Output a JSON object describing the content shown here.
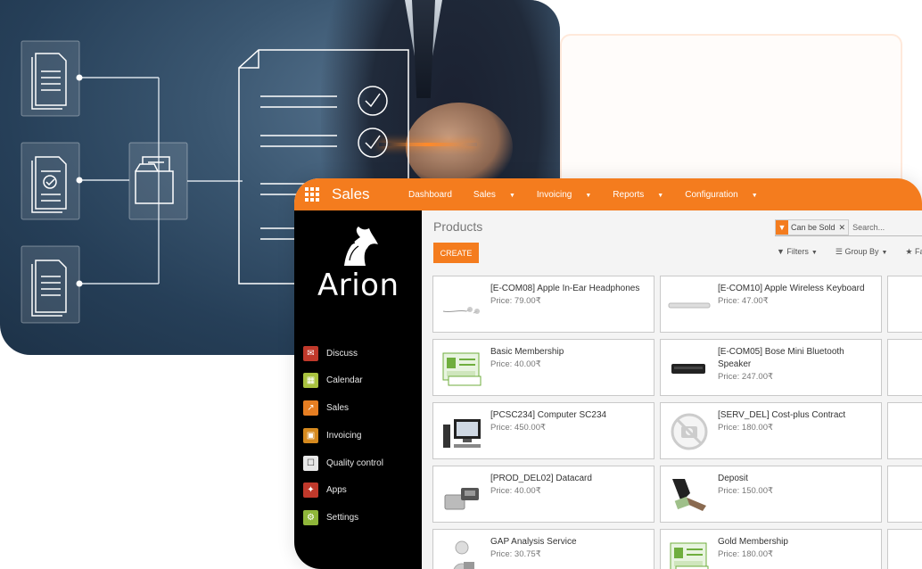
{
  "app": {
    "title": "Sales",
    "menu": [
      "Dashboard",
      "Sales",
      "Invoicing",
      "Reports",
      "Configuration"
    ],
    "menu_dropdown": [
      false,
      true,
      true,
      true,
      true
    ]
  },
  "sidebar": {
    "logo_text": "Arion",
    "items": [
      {
        "label": "Discuss",
        "icon": "discuss-icon",
        "color": "#c0392b"
      },
      {
        "label": "Calendar",
        "icon": "calendar-icon",
        "color": "#a9c23f"
      },
      {
        "label": "Sales",
        "icon": "sales-icon",
        "color": "#e67e22"
      },
      {
        "label": "Invoicing",
        "icon": "invoicing-icon",
        "color": "#d68a1f"
      },
      {
        "label": "Quality control",
        "icon": "quality-control-icon",
        "color": "#e8e8e8"
      },
      {
        "label": "Apps",
        "icon": "apps-icon",
        "color": "#c0392b"
      },
      {
        "label": "Settings",
        "icon": "settings-icon",
        "color": "#8fb63a"
      }
    ]
  },
  "content": {
    "page_title": "Products",
    "create_label": "CREATE",
    "facet_label": "Can be Sold",
    "search_placeholder": "Search...",
    "filters_label": "Filters",
    "group_by_label": "Group By",
    "favorites_label": "Fav"
  },
  "products": [
    {
      "name": "[E-COM08] Apple In-Ear Headphones",
      "price": "Price: 79.00₹",
      "thumb": "headphones"
    },
    {
      "name": "[E-COM10] Apple Wireless Keyboard",
      "price": "Price: 47.00₹",
      "thumb": "keyboard"
    },
    {
      "name": "Basic Membership",
      "price": "Price: 40.00₹",
      "thumb": "membership"
    },
    {
      "name": "[E-COM05] Bose Mini Bluetooth Speaker",
      "price": "Price: 247.00₹",
      "thumb": "speaker"
    },
    {
      "name": "[PCSC234] Computer SC234",
      "price": "Price: 450.00₹",
      "thumb": "computer"
    },
    {
      "name": "[SERV_DEL] Cost-plus Contract",
      "price": "Price: 180.00₹",
      "thumb": "no-image"
    },
    {
      "name": "[PROD_DEL02] Datacard",
      "price": "Price: 40.00₹",
      "thumb": "datacard"
    },
    {
      "name": "Deposit",
      "price": "Price: 150.00₹",
      "thumb": "deposit"
    },
    {
      "name": "GAP Analysis Service",
      "price": "Price: 30.75₹",
      "thumb": "service"
    },
    {
      "name": "Gold Membership",
      "price": "Price: 180.00₹",
      "thumb": "membership"
    }
  ],
  "colors": {
    "accent": "#f47c1e",
    "sidebar_bg": "#000000",
    "hero_bg": "#2c4760"
  }
}
